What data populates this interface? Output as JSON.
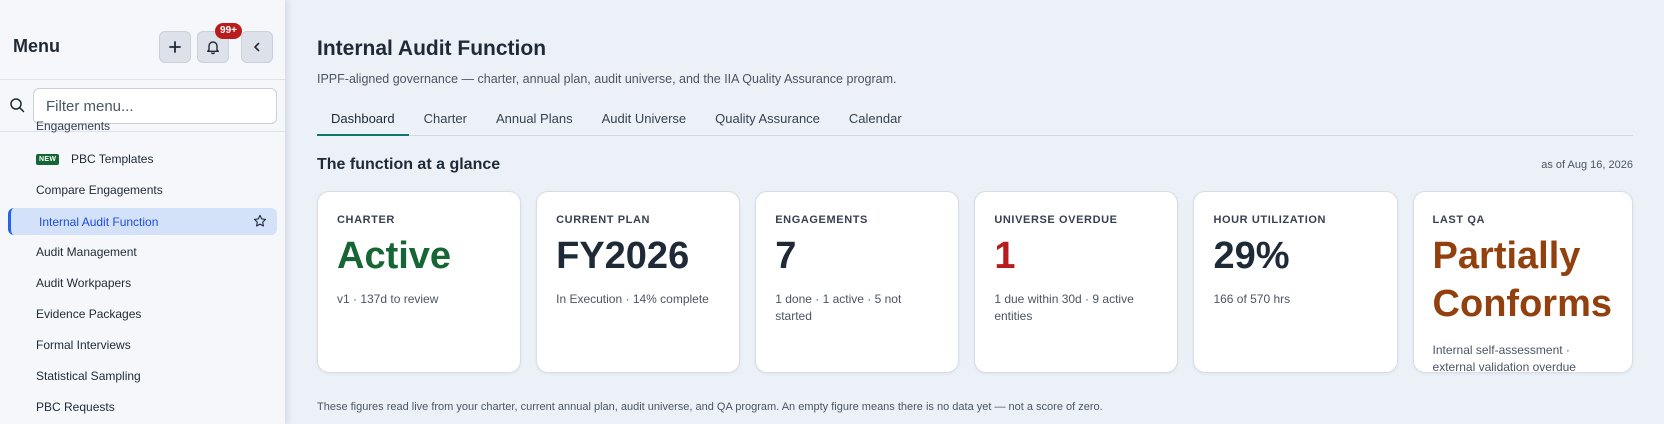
{
  "sidebar": {
    "title": "Menu",
    "notification_badge": "99+",
    "filter_placeholder": "Filter menu...",
    "cut_item": "Engagements",
    "new_badge": "NEW",
    "items": [
      {
        "label": "PBC Templates"
      },
      {
        "label": "Compare Engagements"
      },
      {
        "label": "Internal Audit Function"
      },
      {
        "label": "Audit Management"
      },
      {
        "label": "Audit Workpapers"
      },
      {
        "label": "Evidence Packages"
      },
      {
        "label": "Formal Interviews"
      },
      {
        "label": "Statistical Sampling"
      },
      {
        "label": "PBC Requests"
      }
    ]
  },
  "header": {
    "title": "Internal Audit Function",
    "subtitle": "IPPF-aligned governance — charter, annual plan, audit universe, and the IIA Quality Assurance program."
  },
  "tabs": [
    {
      "label": "Dashboard",
      "active": true
    },
    {
      "label": "Charter"
    },
    {
      "label": "Annual Plans"
    },
    {
      "label": "Audit Universe"
    },
    {
      "label": "Quality Assurance"
    },
    {
      "label": "Calendar"
    }
  ],
  "glance": {
    "title": "The function at a glance",
    "as_of": "as of Aug 16, 2026",
    "cards": [
      {
        "label": "CHARTER",
        "value": "Active",
        "detail": "v1 · 137d to review",
        "color": "#166534"
      },
      {
        "label": "CURRENT PLAN",
        "value": "FY2026",
        "detail": "In Execution · 14% complete"
      },
      {
        "label": "ENGAGEMENTS",
        "value": "7",
        "detail": "1 done · 1 active · 5 not started"
      },
      {
        "label": "UNIVERSE OVERDUE",
        "value": "1",
        "detail": "1 due within 30d · 9 active entities",
        "color": "#b91c1c"
      },
      {
        "label": "HOUR UTILIZATION",
        "value": "29%",
        "detail": "166 of 570 hrs"
      },
      {
        "label": "LAST QA",
        "value_line1": "Partially",
        "value_line2": "Conforms",
        "detail": "Internal self-assessment · external validation overdue",
        "color": "#92400e"
      }
    ],
    "footnote": "These figures read live from your charter, current annual plan, audit universe, and QA program. An empty figure means there is no data yet — not a score of zero."
  },
  "icons": {
    "add": "plus-icon",
    "notifications": "bell-icon",
    "collapse": "chevron-left-icon",
    "search": "search-icon",
    "favorite": "star-icon"
  }
}
